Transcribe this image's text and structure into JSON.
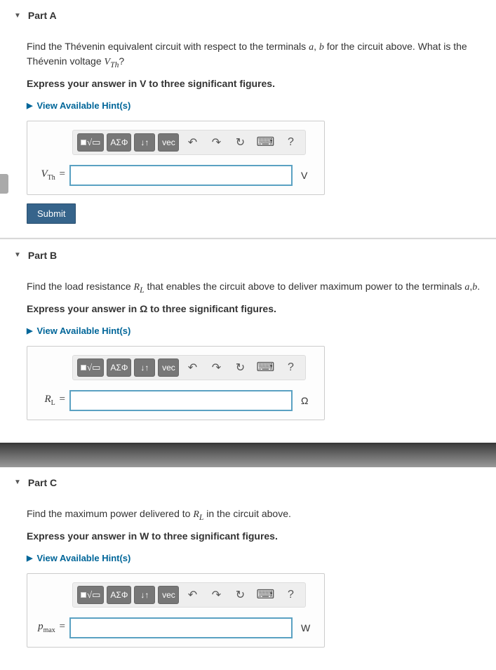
{
  "partA": {
    "title": "Part A",
    "prompt_pre": "Find the Thévenin equivalent circuit with respect to the terminals ",
    "prompt_term_a": "a",
    "prompt_mid1": ", ",
    "prompt_term_b": "b",
    "prompt_mid2": " for the circuit above. What is the Thévenin voltage ",
    "prompt_var": "V",
    "prompt_sub": "Th",
    "prompt_post": "?",
    "instruction": "Express your answer in V to three significant figures.",
    "hints_label": "View Available Hint(s)",
    "var_main": "V",
    "var_sub": "Th",
    "unit": "V",
    "value": "",
    "submit": "Submit"
  },
  "partB": {
    "title": "Part B",
    "prompt_pre": "Find the load resistance ",
    "prompt_var": "R",
    "prompt_sub": "L",
    "prompt_mid": " that enables the circuit above to deliver maximum power to the terminals ",
    "prompt_term_a": "a",
    "prompt_mid1": ",",
    "prompt_term_b": "b",
    "prompt_post": ".",
    "instruction": "Express your answer in Ω to three significant figures.",
    "hints_label": "View Available Hint(s)",
    "var_main": "R",
    "var_sub": "L",
    "unit": "Ω",
    "value": ""
  },
  "partC": {
    "title": "Part C",
    "prompt_pre": "Find the maximum power delivered to ",
    "prompt_var": "R",
    "prompt_sub": "L",
    "prompt_post": " in the circuit above.",
    "instruction": "Express your answer in W to three significant figures.",
    "hints_label": "View Available Hint(s)",
    "var_main": "p",
    "var_sub": "max",
    "unit": "W",
    "value": ""
  },
  "toolbar": {
    "greek": "ΑΣΦ",
    "vec": "vec",
    "help": "?"
  }
}
